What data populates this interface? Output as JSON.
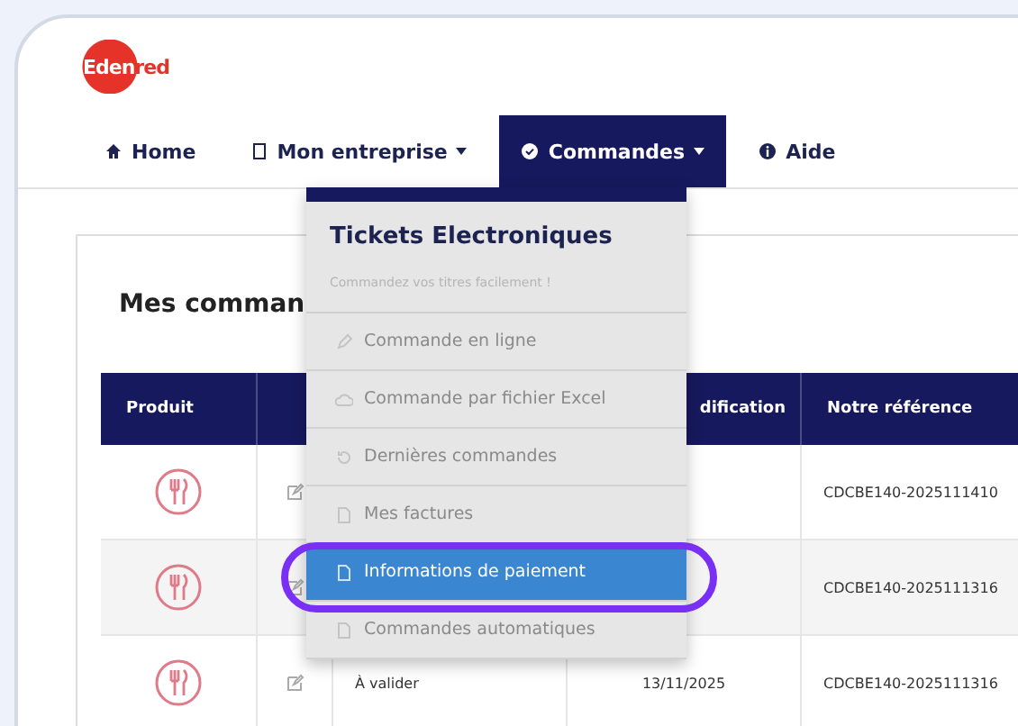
{
  "logo": {
    "text": "Edenred"
  },
  "nav": [
    {
      "label": "Home",
      "selected": false,
      "dropdown": false
    },
    {
      "label": "Mon entreprise",
      "selected": false,
      "dropdown": true
    },
    {
      "label": "Commandes",
      "selected": true,
      "dropdown": true
    },
    {
      "label": "Aide",
      "selected": false,
      "dropdown": false
    }
  ],
  "panel": {
    "title": "Mes comman"
  },
  "table": {
    "columns": [
      "Produit",
      "",
      "",
      "dification",
      "Notre référence"
    ],
    "rows": [
      {
        "reference": "CDCBE140-2025111410"
      },
      {
        "reference": "CDCBE140-2025111316"
      },
      {
        "status": "À valider",
        "date": "13/11/2025",
        "reference": "CDCBE140-2025111316"
      }
    ]
  },
  "menu": {
    "title": "Tickets Electroniques",
    "subtitle": "Commandez vos titres facilement !",
    "items": [
      {
        "label": "Commande en ligne",
        "selected": false,
        "circled": false
      },
      {
        "label": "Commande par fichier Excel",
        "selected": false,
        "circled": false
      },
      {
        "label": "Dernières commandes",
        "selected": false,
        "circled": false
      },
      {
        "label": "Mes factures",
        "selected": false,
        "circled": false
      },
      {
        "label": "Informations de paiement",
        "selected": true,
        "circled": true
      },
      {
        "label": "Commandes automatiques",
        "selected": false,
        "circled": false
      }
    ]
  }
}
